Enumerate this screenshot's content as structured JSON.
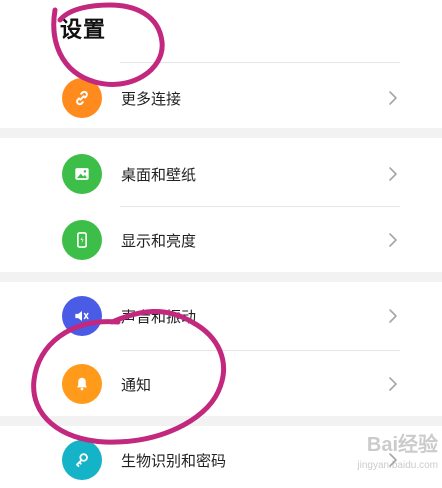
{
  "header": {
    "title": "设置"
  },
  "settings": {
    "items": [
      {
        "label": "更多连接",
        "icon": "link-icon",
        "color": "#FF8A1E"
      },
      {
        "label": "桌面和壁纸",
        "icon": "image-icon",
        "color": "#3DBE49"
      },
      {
        "label": "显示和亮度",
        "icon": "phone-brightness-icon",
        "color": "#3DBE49"
      },
      {
        "label": "声音和振动",
        "icon": "speaker-icon",
        "color": "#4A5BE6"
      },
      {
        "label": "通知",
        "icon": "bell-icon",
        "color": "#FF9A1A"
      },
      {
        "label": "生物识别和密码",
        "icon": "key-icon",
        "color": "#14B3C8"
      }
    ]
  },
  "annotation": {
    "color": "#C2287E"
  },
  "watermark": {
    "text": "Bai经验",
    "sub": "jingyan.baidu.com"
  }
}
